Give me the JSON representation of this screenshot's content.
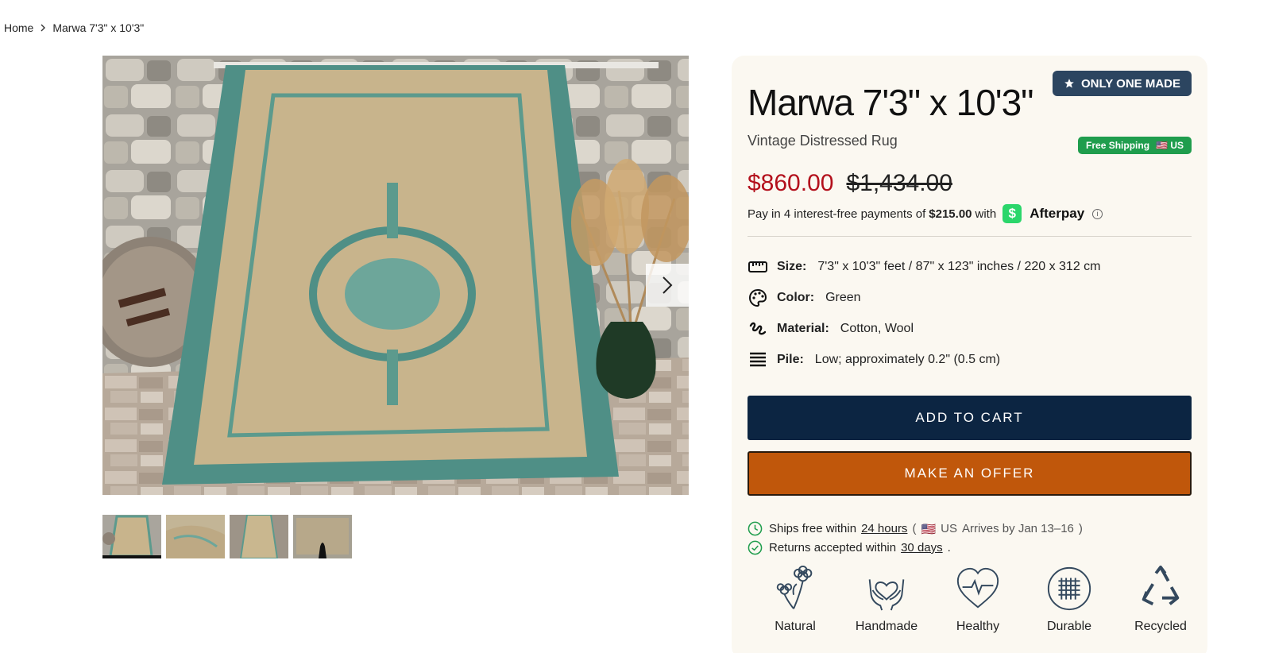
{
  "breadcrumb": {
    "home": "Home",
    "current": "Marwa 7'3\" x 10'3\""
  },
  "gallery": {
    "thumb_count": 4,
    "active_index": 0
  },
  "product": {
    "title": "Marwa 7'3\" x 10'3\"",
    "badge": "ONLY ONE MADE",
    "subtitle": "Vintage Distressed Rug",
    "shipping_badge": {
      "label": "Free Shipping",
      "flag": "🇺🇸",
      "region": "US"
    },
    "price_sale": "$860.00",
    "price_original": "$1,434.00"
  },
  "afterpay": {
    "prefix": "Pay in 4 interest-free payments of",
    "amount": "$215.00",
    "with": "with",
    "logo_glyph": "$",
    "brand": "Afterpay",
    "info": "i"
  },
  "specs": [
    {
      "icon": "ruler-icon",
      "label": "Size:",
      "value": "7'3\" x 10'3\" feet / 87\" x 123\" inches / 220 x 312 cm"
    },
    {
      "icon": "palette-icon",
      "label": "Color:",
      "value": "Green"
    },
    {
      "icon": "yarn-icon",
      "label": "Material:",
      "value": "Cotton, Wool"
    },
    {
      "icon": "pile-icon",
      "label": "Pile:",
      "value": "Low; approximately 0.2\" (0.5 cm)"
    }
  ],
  "buttons": {
    "add_to_cart": "ADD TO CART",
    "make_offer": "MAKE AN OFFER"
  },
  "shipping": {
    "ships_prefix": "Ships free within",
    "ships_link": "24 hours",
    "open_paren": "(",
    "flag": "🇺🇸",
    "region": "US",
    "arrives": "Arrives by Jan 13–16",
    "close_paren": ")",
    "returns_prefix": "Returns accepted within",
    "returns_link": "30 days",
    "returns_suffix": "."
  },
  "features": [
    {
      "icon": "flowers-icon",
      "label": "Natural"
    },
    {
      "icon": "hands-heart-icon",
      "label": "Handmade"
    },
    {
      "icon": "heartbeat-icon",
      "label": "Healthy"
    },
    {
      "icon": "woven-icon",
      "label": "Durable"
    },
    {
      "icon": "recycle-icon",
      "label": "Recycled"
    }
  ],
  "colors": {
    "navy": "#0c2542",
    "orange": "#c0570b",
    "sale_red": "#b3101c",
    "badge_blue": "#2c4560",
    "green": "#1f9d4d",
    "panel_bg": "#fbf8f1"
  }
}
